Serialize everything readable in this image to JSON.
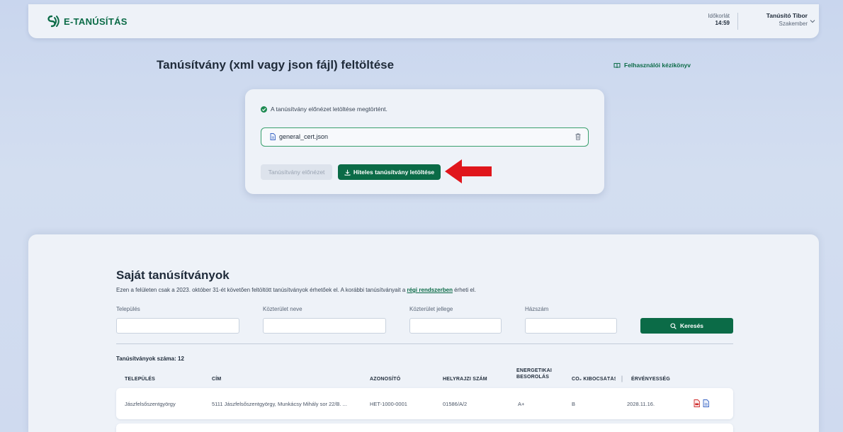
{
  "header": {
    "app_name": "E-TANÚSÍTÁS",
    "timer_label": "Időkorlát",
    "timer_value": "14:59",
    "user_name": "Tanúsító Tibor",
    "user_role": "Szakember"
  },
  "upload": {
    "title": "Tanúsítvány (xml vagy json fájl) feltöltése",
    "manual_link": "Felhasználói kézikönyv",
    "success_message": "A tanúsítvány előnézet letöltése megtörtént.",
    "file_name": "general_cert.json",
    "preview_button": "Tanúsítvány előnézet",
    "download_button": "Hiteles tanúsítvány letöltése"
  },
  "list": {
    "title": "Saját tanúsítványok",
    "description_before": "Ezen a felületen csak a 2023. október 31-ét követően feltöltött tanúsítványok érhetőek el. A korábbi tanúsítványait a ",
    "description_link": "régi rendszerben",
    "description_after": " érheti el.",
    "filters": {
      "settlement_label": "Település",
      "street_name_label": "Közterület neve",
      "street_type_label": "Közterület jellege",
      "house_number_label": "Házszám",
      "search_button": "Keresés"
    },
    "count_label": "Tanúsítványok száma: 12",
    "columns": {
      "settlement": "TELEPÜLÉS",
      "address": "CÍM",
      "id": "AZONOSÍTÓ",
      "parcel": "HELYRAJZI SZÁM",
      "energy_line1": "ENERGETIKAI",
      "energy_line2": "BESOROLÁS",
      "co2": "CO₂ KIBOCSÁTÁS",
      "validity": "ÉRVÉNYESSÉG"
    },
    "rows": [
      {
        "settlement": "Jászfelsőszentgyörgy",
        "address": "5111 Jászfelsőszentgyörgy, Munkácsy Mihály sor 22/B. ...",
        "id": "HET-1000-0001",
        "parcel": "01586/A/2",
        "energy": "A+",
        "co2": "B",
        "validity": "2028.11.16."
      }
    ]
  },
  "colors": {
    "brand_green": "#0b6b47",
    "arrow_red": "#e0161c"
  }
}
